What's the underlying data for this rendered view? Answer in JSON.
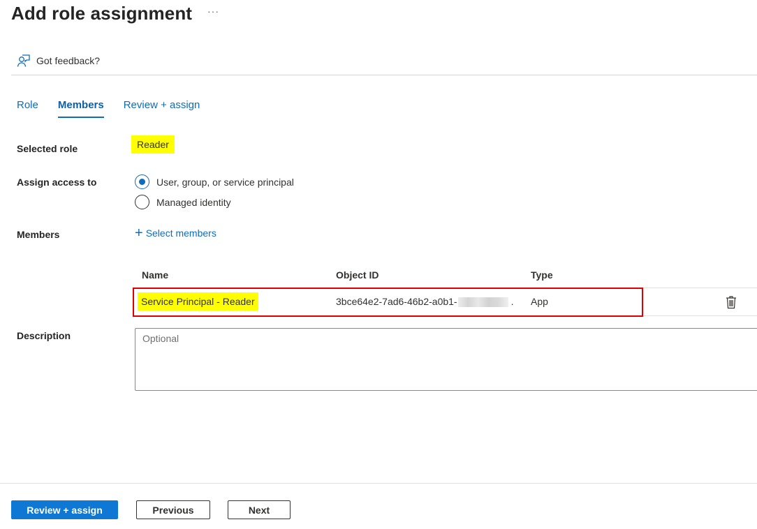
{
  "header": {
    "title": "Add role assignment",
    "more_label": "···"
  },
  "toolbar": {
    "feedback_label": "Got feedback?",
    "feedback_icon": "feedback-person-icon"
  },
  "tabs": [
    {
      "label": "Role",
      "active": false
    },
    {
      "label": "Members",
      "active": true
    },
    {
      "label": "Review + assign",
      "active": false
    }
  ],
  "form": {
    "selected_role_label": "Selected role",
    "selected_role_value": "Reader",
    "assign_access_label": "Assign access to",
    "assign_options": [
      {
        "label": "User, group, or service principal",
        "checked": true
      },
      {
        "label": "Managed identity",
        "checked": false
      }
    ],
    "members_label": "Members",
    "select_members_label": "Select members",
    "select_members_icon": "plus-icon",
    "description_label": "Description",
    "description_placeholder": "Optional",
    "description_value": ""
  },
  "members_table": {
    "columns": [
      "Name",
      "Object ID",
      "Type"
    ],
    "rows": [
      {
        "name": "Service Principal - Reader",
        "object_id": "3bce64e2-7ad6-46b2-a0b1-",
        "object_id_suffix": ".",
        "type": "App",
        "highlighted": true
      }
    ]
  },
  "footer": {
    "review_assign_label": "Review + assign",
    "previous_label": "Previous",
    "next_label": "Next"
  },
  "colors": {
    "accent": "#0f6cbd",
    "primary_button": "#0f78d4",
    "highlight": "#ffff00",
    "row_outline": "#e00000"
  }
}
